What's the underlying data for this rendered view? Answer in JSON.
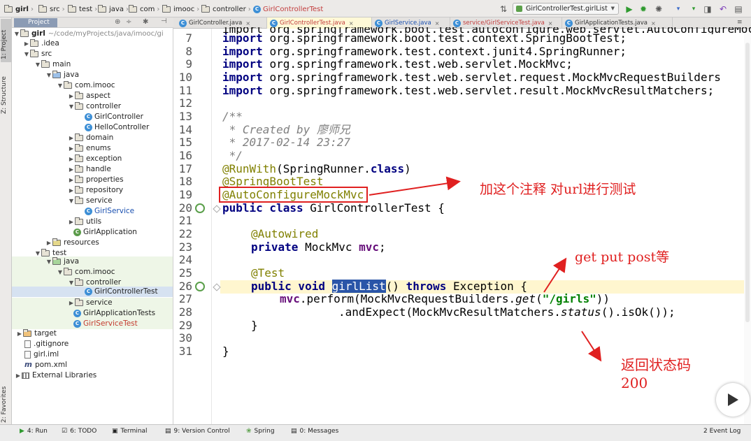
{
  "navbar": {
    "crumbs": [
      "girl",
      "src",
      "test",
      "java",
      "com",
      "imooc",
      "controller",
      "GirlControllerTest"
    ],
    "run_config": "GirlControllerTest.girlList"
  },
  "left_strip": {
    "project": "1: Project",
    "structure": "Z: Structure",
    "favorites": "2: Favorites"
  },
  "project_panel": {
    "tab_label": "Project",
    "tree": [
      {
        "label": "girl",
        "extra": "~/code/myProjects/java/imooc/gi"
      },
      {
        "label": ".idea"
      },
      {
        "label": "src"
      },
      {
        "label": "main"
      },
      {
        "label": "java"
      },
      {
        "label": "com.imooc"
      },
      {
        "label": "aspect"
      },
      {
        "label": "controller"
      },
      {
        "label": "GirlController"
      },
      {
        "label": "HelloController"
      },
      {
        "label": "domain"
      },
      {
        "label": "enums"
      },
      {
        "label": "exception"
      },
      {
        "label": "handle"
      },
      {
        "label": "properties"
      },
      {
        "label": "repository"
      },
      {
        "label": "service"
      },
      {
        "label": "GirlService"
      },
      {
        "label": "utils"
      },
      {
        "label": "GirlApplication"
      },
      {
        "label": "resources"
      },
      {
        "label": "test"
      },
      {
        "label": "java"
      },
      {
        "label": "com.imooc"
      },
      {
        "label": "controller"
      },
      {
        "label": "GirlControllerTest"
      },
      {
        "label": "service"
      },
      {
        "label": "GirlApplicationTests"
      },
      {
        "label": "GirlServiceTest"
      },
      {
        "label": "target"
      },
      {
        "label": ".gitignore"
      },
      {
        "label": "girl.iml"
      },
      {
        "label": "pom.xml"
      },
      {
        "label": "External Libraries"
      }
    ]
  },
  "tabs": [
    {
      "label": "GirlController.java",
      "close": "×"
    },
    {
      "label": "GirlControllerTest.java",
      "close": "×"
    },
    {
      "label": "GirlService.java",
      "close": "×"
    },
    {
      "label": "service/GirlServiceTest.java",
      "close": "×"
    },
    {
      "label": "GirlApplicationTests.java",
      "close": "×"
    }
  ],
  "editor": {
    "line_numbers": [
      "7",
      "8",
      "9",
      "10",
      "11",
      "12",
      "13",
      "14",
      "15",
      "16",
      "17",
      "18",
      "19",
      "20",
      "21",
      "22",
      "23",
      "24",
      "25",
      "26",
      "27",
      "28",
      "29",
      "30",
      "31"
    ],
    "partial_top": "import org.springframework.boot.test.autoconfigure.web.servlet.AutoConfigureMockMvc;",
    "lines": {
      "l7": "org.springframework.boot.test.context.SpringBootTest;",
      "l8": "org.springframework.test.context.junit4.SpringRunner;",
      "l9": "org.springframework.test.web.servlet.MockMvc;",
      "l10": "org.springframework.test.web.servlet.request.MockMvcRequestBuilders",
      "l11": "org.springframework.test.web.servlet.result.MockMvcResultMatchers;",
      "import_kw": "import",
      "l13": "/**",
      "l14": " * Created by 廖师兄",
      "l15": " * 2017-02-14 23:27",
      "l16": " */",
      "l17_an": "@RunWith",
      "l17_rest": "(SpringRunner.",
      "l17_kw": "class",
      "l17_end": ")",
      "l18": "@SpringBootTest",
      "l19": "@AutoConfigureMockMvc",
      "l20_kw": "public class",
      "l20_rest": " GirlControllerTest {",
      "l22": "@Autowired",
      "l23_kw": "private",
      "l23_type": " MockMvc ",
      "l23_fld": "mvc",
      "l23_end": ";",
      "l25": "@Test",
      "l26_kw": "public void",
      "l26_name": "girlList",
      "l26_paren": "() ",
      "l26_throws": "throws",
      "l26_rest": " Exception {",
      "l27_fld": "mvc",
      "l27_a": ".perform(MockMvcRequestBuilders.",
      "l27_get": "get",
      "l27_b": "(",
      "l27_str": "\"/girls\"",
      "l27_c": "))",
      "l28_a": ".andExpect(MockMvcResultMatchers.",
      "l28_status": "status",
      "l28_b": "().isOk());",
      "l29": "}",
      "l31": "}"
    }
  },
  "annotations": {
    "note1": "加这个注释  对url进行测试",
    "note2": "get put post等",
    "note3_line1": "返回状态码",
    "note3_line2": "200"
  },
  "bottom_bar": {
    "run": "4: Run",
    "todo": "6: TODO",
    "terminal": "Terminal",
    "vcs": "9: Version Control",
    "spring": "Spring",
    "messages": "0: Messages",
    "event_log": "2 Event Log"
  },
  "colors": {
    "annotation_red": "#e02020",
    "keyword": "#000080",
    "annotation_olive": "#808000"
  }
}
